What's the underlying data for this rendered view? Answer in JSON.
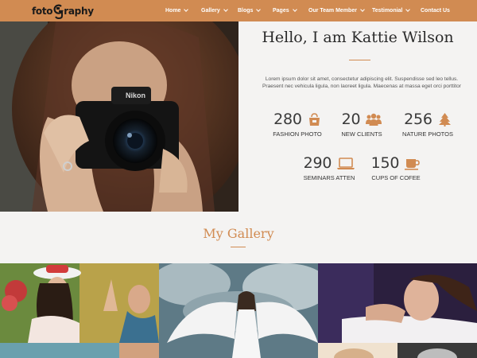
{
  "brand": {
    "logo_part1": "foto",
    "logo_part2": "raphy"
  },
  "nav": {
    "items": [
      {
        "label": "Home",
        "dropdown": true
      },
      {
        "label": "Gallery",
        "dropdown": true
      },
      {
        "label": "Blogs",
        "dropdown": true
      },
      {
        "label": "Pages",
        "dropdown": true
      },
      {
        "label": "Our Team Member",
        "dropdown": true
      },
      {
        "label": "Testimonial",
        "dropdown": true
      },
      {
        "label": "Contact Us",
        "dropdown": false
      }
    ]
  },
  "profile": {
    "heading": "Hello, I am Kattie Wilson",
    "bio": "Lorem ipsum dolor sit amet, consectetur adipiscing elit. Suspendisse sed leo tellus. Praesent nec vehicula ligula, non laoreet ligula. Maecenas at massa eget orci porttitor",
    "stats": [
      {
        "value": "280",
        "label": "FASHION PHOTO",
        "icon": "bag-icon"
      },
      {
        "value": "20",
        "label": "NEW CLIENTS",
        "icon": "users-icon"
      },
      {
        "value": "256",
        "label": "NATURE PHOTOS",
        "icon": "tree-icon"
      },
      {
        "value": "290",
        "label": "SEMINARS ATTEN",
        "icon": "laptop-icon"
      },
      {
        "value": "150",
        "label": "CUPS OF COFEE",
        "icon": "coffee-icon"
      }
    ]
  },
  "gallery": {
    "title": "My Gallery"
  },
  "colors": {
    "accent": "#d18b52",
    "background": "#f4f3f2",
    "text_dark": "#2b2b2b"
  }
}
